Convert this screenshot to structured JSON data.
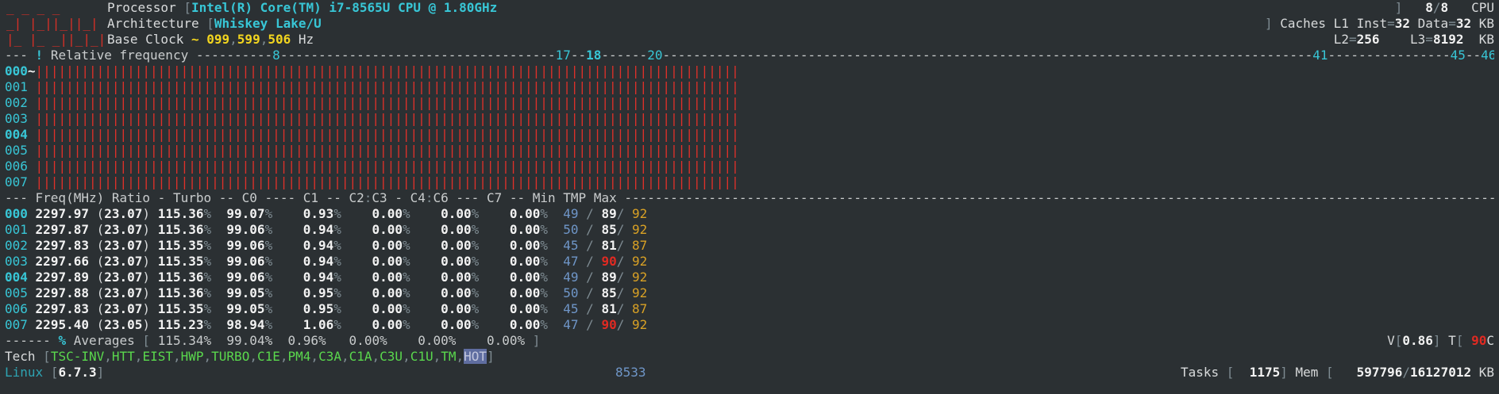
{
  "logo": {
    "line1": "_ _ _ _",
    "line2": "_| |_||_||_|",
    "line3": "|_ |_ _||_|_|"
  },
  "header": {
    "processor_label": "Processor",
    "processor_value": "Intel(R) Core(TM) i7-8565U CPU @ 1.80GHz",
    "arch_label": "Architecture",
    "arch_value": "Whiskey Lake/U",
    "clock_label": "Base Clock",
    "clock_tilde": "~",
    "clock_a": "099",
    "clock_b": "599",
    "clock_c": "506",
    "clock_unit": "Hz",
    "cpu_count_a": "8",
    "cpu_count_b": "8",
    "cpu_label": "CPU",
    "caches_label": "Caches",
    "l1_inst_label": "L1 Inst",
    "l1_inst_value": "32",
    "l1_data_label": "Data",
    "l1_data_value": "32",
    "cache_unit": "KB",
    "l2_label": "L2",
    "l2_value": "256",
    "l3_label": "L3",
    "l3_value": "8192"
  },
  "freq_ruler": {
    "bang": "!",
    "label": "Relative frequency",
    "marks": [
      "8",
      "17",
      "18",
      "20",
      "41",
      "45",
      "46"
    ]
  },
  "bar_rows": [
    {
      "id": "000",
      "suffix": "~"
    },
    {
      "id": "001",
      "suffix": ""
    },
    {
      "id": "002",
      "suffix": ""
    },
    {
      "id": "003",
      "suffix": ""
    },
    {
      "id": "004",
      "suffix": ""
    },
    {
      "id": "005",
      "suffix": ""
    },
    {
      "id": "006",
      "suffix": ""
    },
    {
      "id": "007",
      "suffix": ""
    }
  ],
  "table": {
    "headers": [
      "Freq(MHz)",
      "Ratio",
      "Turbo",
      "C0",
      "C1",
      "C2",
      "C3",
      "C4",
      "C6",
      "C7",
      "Min",
      "TMP",
      "Max"
    ],
    "rows": [
      {
        "id": "000",
        "freq": "2297.97",
        "ratio": "23.07",
        "turbo": "115.36",
        "c0": "99.07",
        "c1": "0.93",
        "c3": "0.00",
        "c6": "0.00",
        "c7": "0.00",
        "min": "49",
        "tmp": "89",
        "max": "92",
        "hot": false,
        "maxhi": false
      },
      {
        "id": "001",
        "freq": "2297.87",
        "ratio": "23.07",
        "turbo": "115.36",
        "c0": "99.06",
        "c1": "0.94",
        "c3": "0.00",
        "c6": "0.00",
        "c7": "0.00",
        "min": "50",
        "tmp": "85",
        "max": "92",
        "hot": false,
        "maxhi": false
      },
      {
        "id": "002",
        "freq": "2297.83",
        "ratio": "23.07",
        "turbo": "115.35",
        "c0": "99.06",
        "c1": "0.94",
        "c3": "0.00",
        "c6": "0.00",
        "c7": "0.00",
        "min": "45",
        "tmp": "81",
        "max": "87",
        "hot": false,
        "maxhi": false
      },
      {
        "id": "003",
        "freq": "2297.66",
        "ratio": "23.07",
        "turbo": "115.35",
        "c0": "99.06",
        "c1": "0.94",
        "c3": "0.00",
        "c6": "0.00",
        "c7": "0.00",
        "min": "47",
        "tmp": "90",
        "max": "92",
        "hot": true,
        "maxhi": false
      },
      {
        "id": "004",
        "freq": "2297.89",
        "ratio": "23.07",
        "turbo": "115.36",
        "c0": "99.06",
        "c1": "0.94",
        "c3": "0.00",
        "c6": "0.00",
        "c7": "0.00",
        "min": "49",
        "tmp": "89",
        "max": "92",
        "hot": false,
        "maxhi": false
      },
      {
        "id": "005",
        "freq": "2297.88",
        "ratio": "23.07",
        "turbo": "115.36",
        "c0": "99.05",
        "c1": "0.95",
        "c3": "0.00",
        "c6": "0.00",
        "c7": "0.00",
        "min": "50",
        "tmp": "85",
        "max": "92",
        "hot": false,
        "maxhi": false
      },
      {
        "id": "006",
        "freq": "2297.83",
        "ratio": "23.07",
        "turbo": "115.35",
        "c0": "99.05",
        "c1": "0.95",
        "c3": "0.00",
        "c6": "0.00",
        "c7": "0.00",
        "min": "45",
        "tmp": "81",
        "max": "87",
        "hot": false,
        "maxhi": false
      },
      {
        "id": "007",
        "freq": "2295.40",
        "ratio": "23.05",
        "turbo": "115.23",
        "c0": "98.94",
        "c1": "1.06",
        "c3": "0.00",
        "c6": "0.00",
        "c7": "0.00",
        "min": "47",
        "tmp": "90",
        "max": "92",
        "hot": true,
        "maxhi": false
      }
    ]
  },
  "averages": {
    "percent": "%",
    "label": "Averages",
    "turbo": "115.34%",
    "c0": "99.04%",
    "c1": "0.96%",
    "c3": "0.00%",
    "c6": "0.00%",
    "c7": "0.00%",
    "volt_label": "V",
    "volt_value": "0.86",
    "temp_label": "T",
    "temp_value": "90",
    "temp_unit": "C"
  },
  "tech": {
    "label": "Tech",
    "items": [
      "TSC-INV",
      "HTT",
      "EIST",
      "HWP",
      "TURBO",
      "C1E",
      "PM4",
      "C3A",
      "C1A",
      "C3U",
      "C1U",
      "TM"
    ],
    "hot_item": "HOT"
  },
  "footer": {
    "os": "Linux",
    "kernel": "6.7.3",
    "center_value": "8533",
    "tasks_label": "Tasks",
    "tasks_value": "1175",
    "mem_label": "Mem",
    "mem_used": "597796",
    "mem_total": "16127012",
    "mem_unit": "KB"
  },
  "colors": {
    "background": "#2b3033",
    "cyan": "#38c6d6",
    "red": "#e0302a",
    "yellow": "#f2d51f",
    "blue": "#6f96c8",
    "orange": "#d9a125",
    "green": "#5ad84d"
  }
}
